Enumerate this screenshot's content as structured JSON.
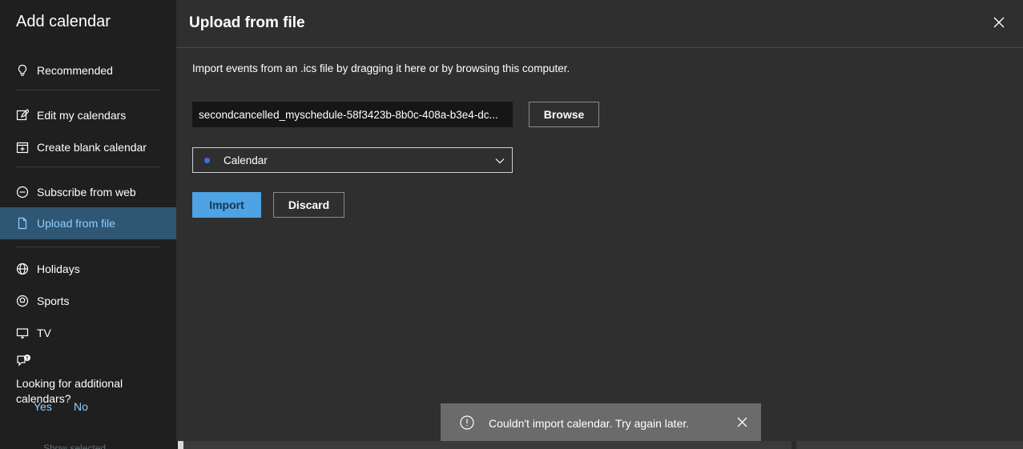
{
  "sidebar": {
    "title": "Add calendar",
    "items": [
      {
        "label": "Recommended",
        "icon": "lightbulb-icon"
      },
      {
        "label": "Edit my calendars",
        "icon": "edit-icon"
      },
      {
        "label": "Create blank calendar",
        "icon": "add-calendar-icon"
      },
      {
        "label": "Subscribe from web",
        "icon": "globe-link-icon"
      },
      {
        "label": "Upload from file",
        "icon": "file-icon",
        "active": true
      },
      {
        "label": "Holidays",
        "icon": "globe-icon"
      },
      {
        "label": "Sports",
        "icon": "sports-ball-icon"
      },
      {
        "label": "TV",
        "icon": "tv-icon"
      }
    ],
    "feedback": {
      "question": "Looking for additional calendars?",
      "yes": "Yes",
      "no": "No"
    }
  },
  "main": {
    "title": "Upload from file",
    "description": "Import events from an .ics file by dragging it here or by browsing this computer.",
    "file_value": "secondcancelled_myschedule-58f3423b-8b0c-408a-b3e4-dc...",
    "browse_label": "Browse",
    "calendar_select": "Calendar",
    "import_label": "Import",
    "discard_label": "Discard"
  },
  "toast": {
    "message": "Couldn't import calendar. Try again later."
  },
  "background": {
    "hint": "Show selected"
  },
  "colors": {
    "accent": "#4da3e3",
    "active_bg": "#2f5673",
    "calendar_dot": "#3d6ee8"
  }
}
